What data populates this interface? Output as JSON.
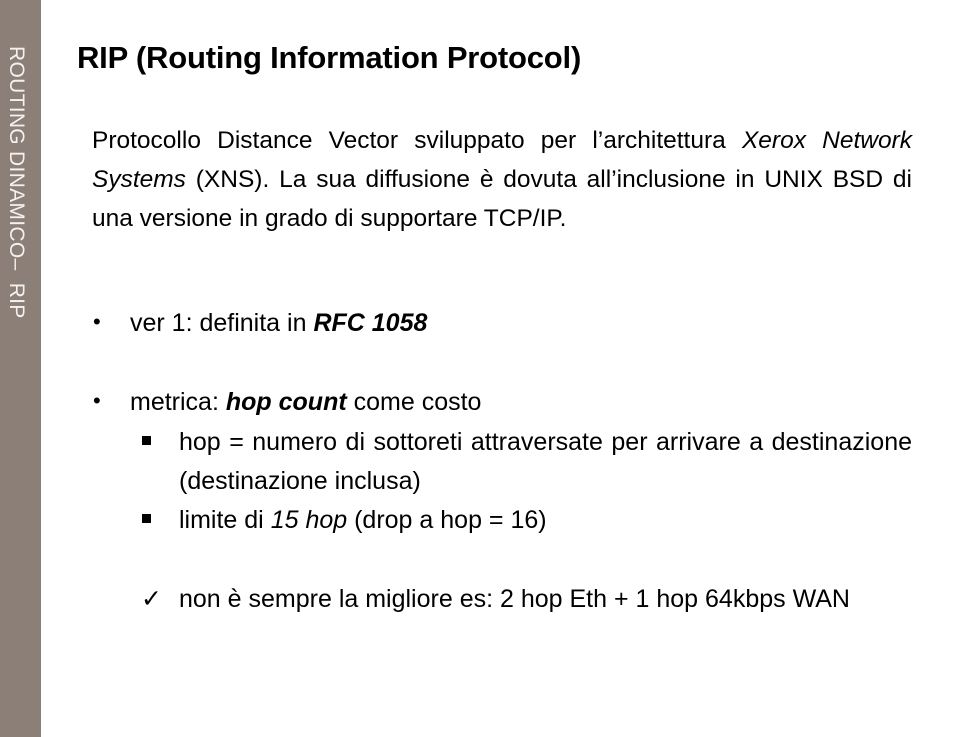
{
  "sidebar": {
    "label": "ROUTING DINAMICO–  RIP"
  },
  "slide": {
    "title": "RIP (Routing Information Protocol)",
    "intro": {
      "p1": "Protocollo Distance Vector sviluppato per l’architettura ",
      "p1_italic": "Xerox Network Systems",
      "p2": " (XNS). La sua diffusione è dovuta all’inclusione in UNIX BSD di una versione in grado di supportare TCP/IP."
    },
    "bullets": [
      {
        "marker": "•",
        "text": "ver 1: definita in ",
        "emph": "RFC 1058"
      },
      {
        "marker": "•",
        "text": "metrica: ",
        "emph": "hop count",
        "tail": " come costo"
      }
    ],
    "sub_bullets": [
      {
        "marker": "square",
        "text": "hop = numero di sottoreti attraversate per arrivare a destinazione (destinazione inclusa)"
      },
      {
        "marker": "square",
        "text": "limite di ",
        "emph": "15 hop",
        "tail": " (drop a hop = 16)"
      }
    ],
    "check_item": {
      "marker": "✓",
      "text": "non è sempre la migliore es: 2 hop Eth + 1 hop 64kbps WAN"
    }
  },
  "colors": {
    "sidebar": "#8b7f78",
    "sidebar_text": "#f4f1ee"
  }
}
